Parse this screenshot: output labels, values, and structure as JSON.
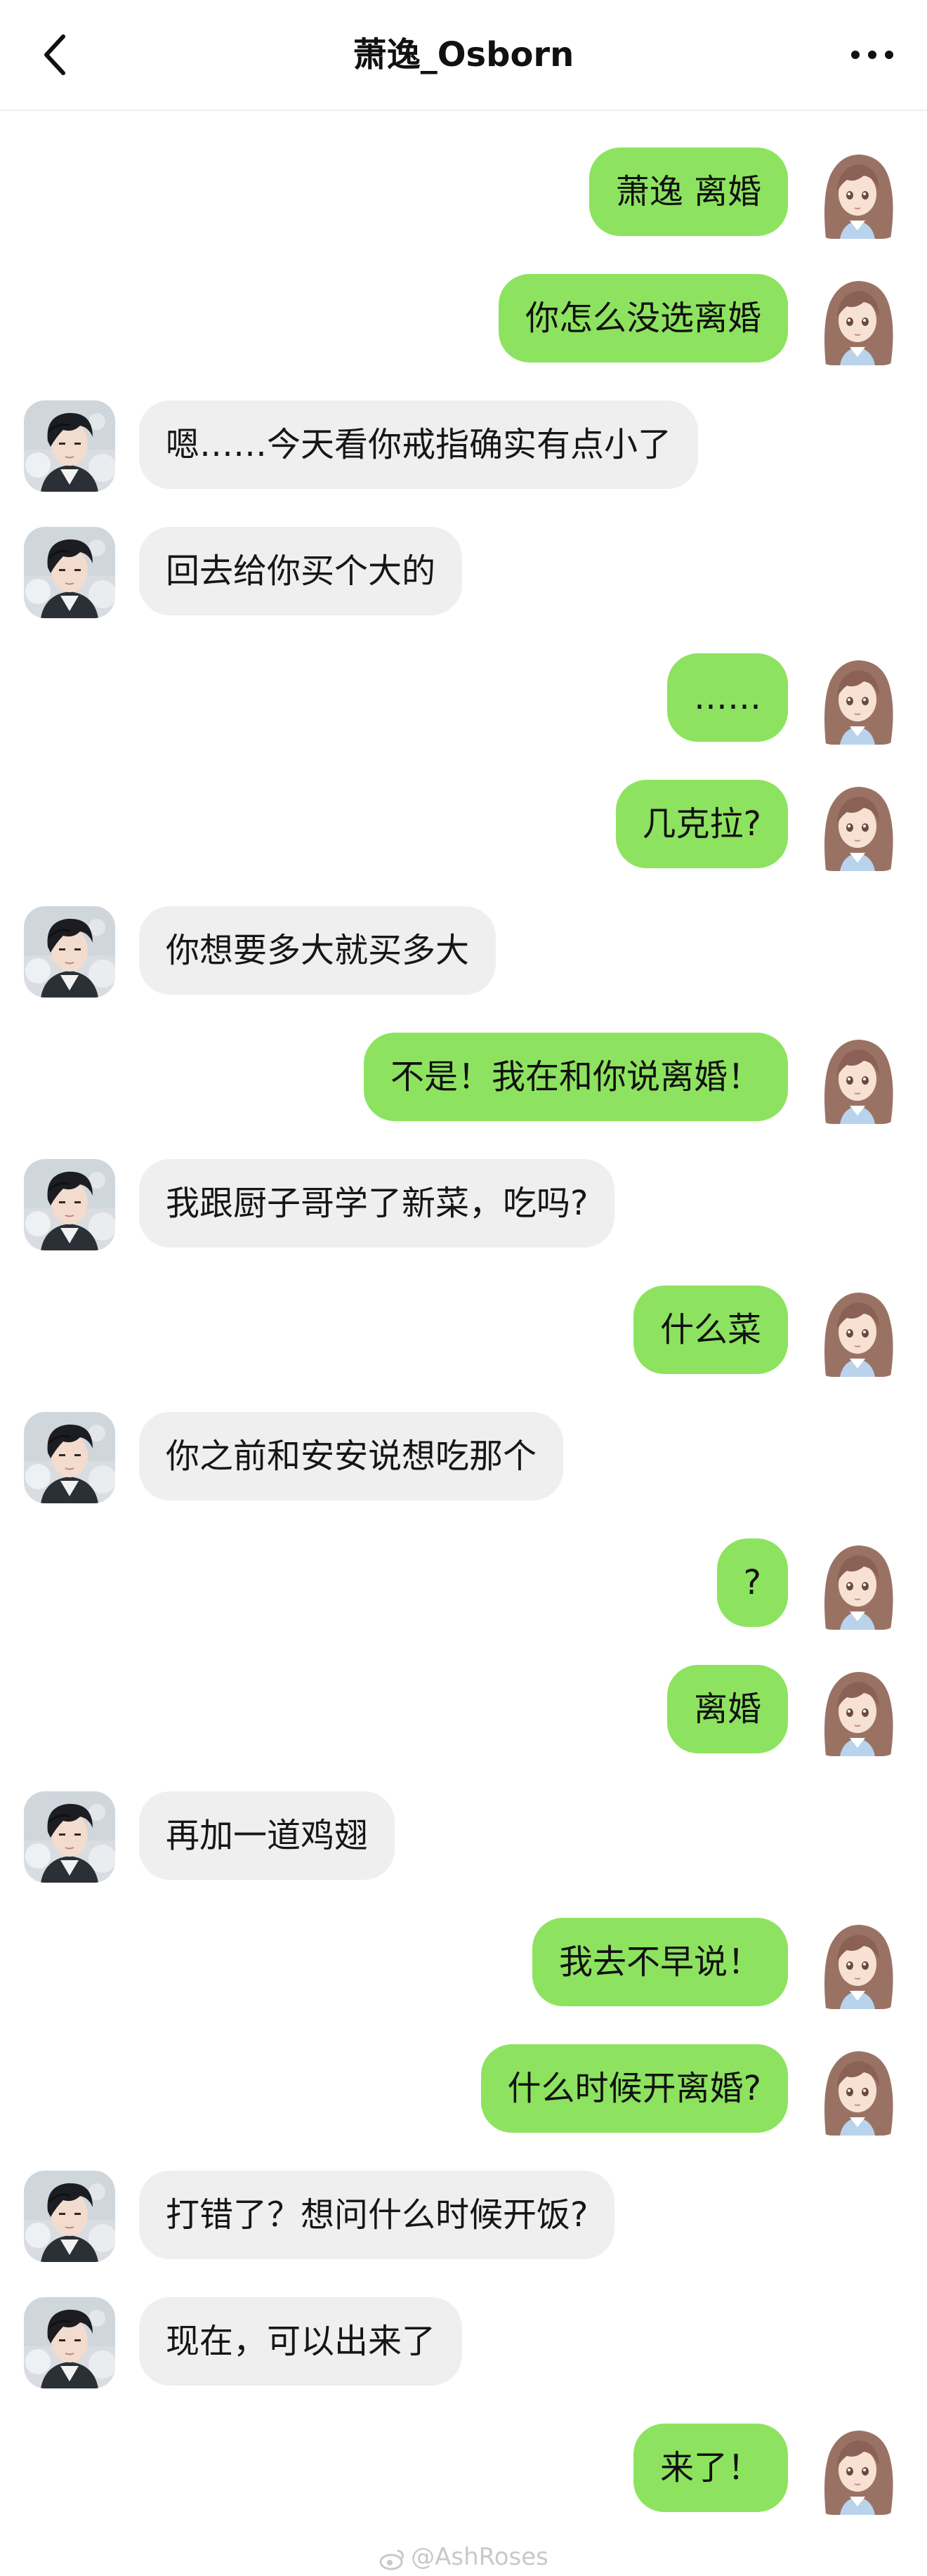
{
  "header": {
    "title": "萧逸_Osborn",
    "back_icon": "chevron-left-icon",
    "more_icon": "more-horizontal-icon"
  },
  "colors": {
    "sent_bubble": "#8de35f",
    "received_bubble": "#efefef",
    "background": "#ffffff"
  },
  "messages": [
    {
      "side": "right",
      "text": "萧逸 离婚"
    },
    {
      "side": "right",
      "text": "你怎么没选离婚"
    },
    {
      "side": "left",
      "text": "嗯……今天看你戒指确实有点小了"
    },
    {
      "side": "left",
      "text": "回去给你买个大的"
    },
    {
      "side": "right",
      "text": "……"
    },
    {
      "side": "right",
      "text": "几克拉?"
    },
    {
      "side": "left",
      "text": "你想要多大就买多大"
    },
    {
      "side": "right",
      "text": "不是！我在和你说离婚！"
    },
    {
      "side": "left",
      "text": "我跟厨子哥学了新菜，吃吗?"
    },
    {
      "side": "right",
      "text": "什么菜"
    },
    {
      "side": "left",
      "text": "你之前和安安说想吃那个"
    },
    {
      "side": "right",
      "text": "?"
    },
    {
      "side": "right",
      "text": "离婚"
    },
    {
      "side": "left",
      "text": "再加一道鸡翅"
    },
    {
      "side": "right",
      "text": "我去不早说！"
    },
    {
      "side": "right",
      "text": "什么时候开离婚?"
    },
    {
      "side": "left",
      "text": "打错了？想问什么时候开饭?"
    },
    {
      "side": "left",
      "text": "现在，可以出来了"
    },
    {
      "side": "right",
      "text": "来了！"
    }
  ],
  "watermark": "@AshRoses"
}
